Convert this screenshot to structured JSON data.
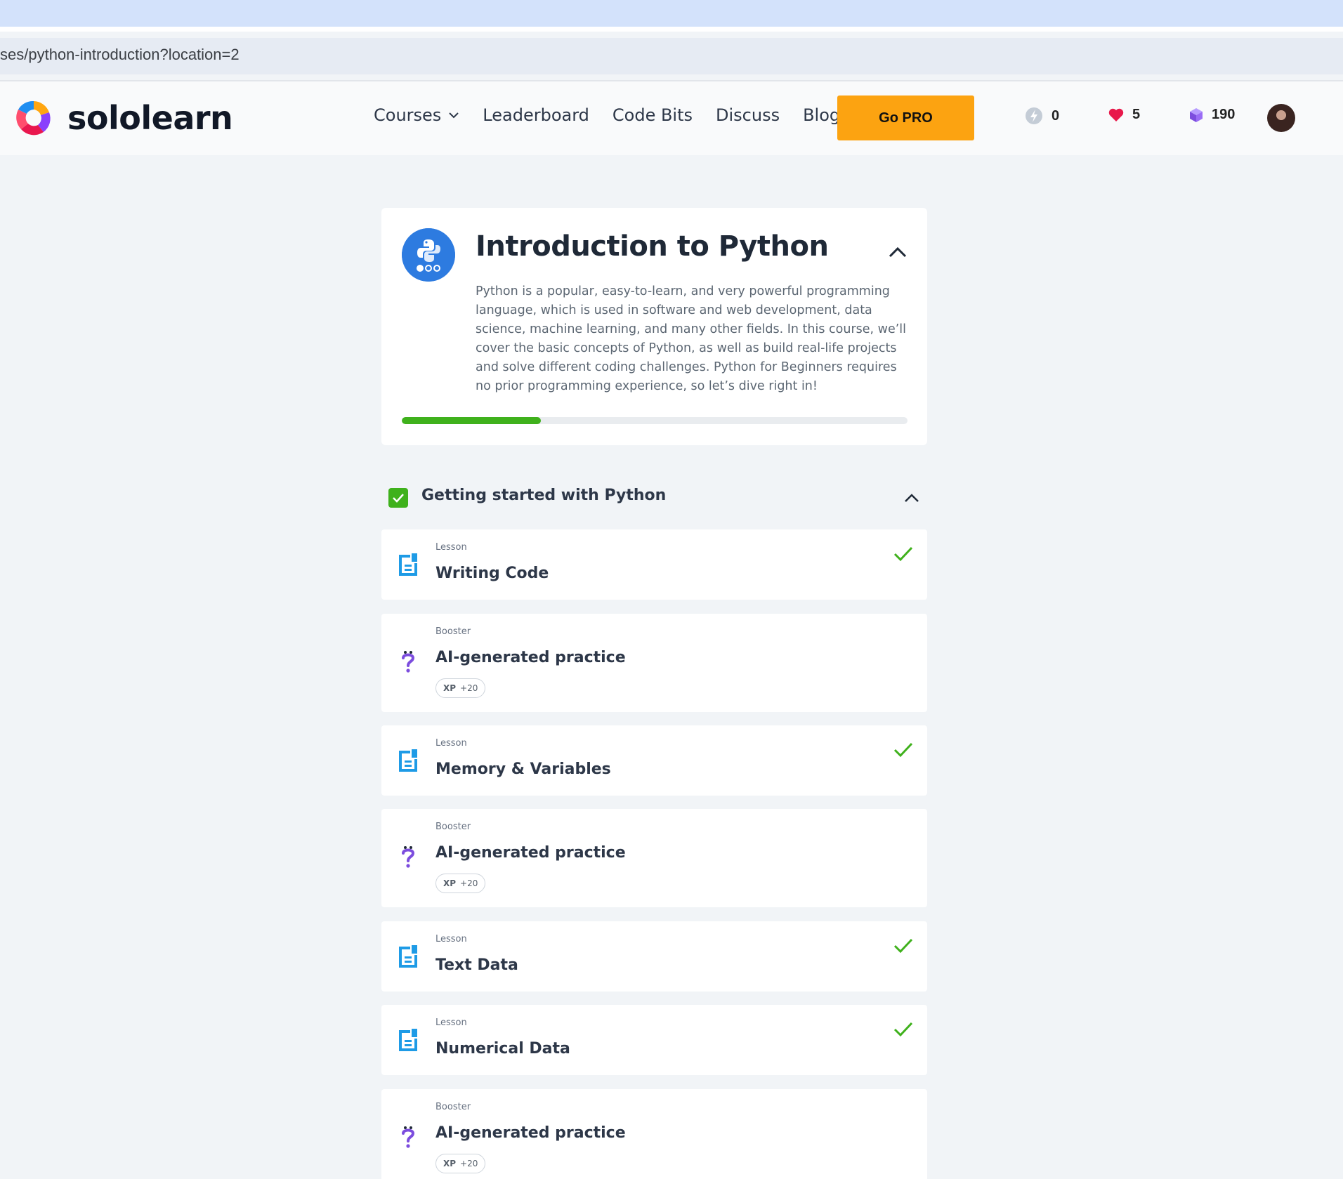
{
  "browser": {
    "url": "ses/python-introduction?location=2"
  },
  "nav": {
    "brand": "sololearn",
    "links": [
      {
        "label": "Courses",
        "has_dropdown": true
      },
      {
        "label": "Leaderboard"
      },
      {
        "label": "Code Bits"
      },
      {
        "label": "Discuss"
      },
      {
        "label": "Blog"
      }
    ],
    "go_pro_label": "Go PRO",
    "stats": {
      "streak": "0",
      "hearts": "5",
      "gems": "190"
    }
  },
  "course": {
    "title": "Introduction to Python",
    "description": "Python is a popular, easy-to-learn, and very powerful programming language, which is used in software and web development, data science, machine learning, and many other fields. In this course, we’ll cover the basic concepts of Python, as well as build real-life projects and solve different coding challenges. Python for Beginners requires no prior programming experience, so let’s dive right in!",
    "progress": 0.275
  },
  "module": {
    "title": "Getting started with Python",
    "completed": true,
    "items": [
      {
        "kind": "Lesson",
        "title": "Writing Code",
        "completed": true
      },
      {
        "kind": "Booster",
        "title": "AI-generated practice",
        "xp_label": "XP",
        "xp_value": "+20"
      },
      {
        "kind": "Lesson",
        "title": "Memory & Variables",
        "completed": true
      },
      {
        "kind": "Booster",
        "title": "AI-generated practice",
        "xp_label": "XP",
        "xp_value": "+20"
      },
      {
        "kind": "Lesson",
        "title": "Text Data",
        "completed": true
      },
      {
        "kind": "Lesson",
        "title": "Numerical Data",
        "completed": true
      },
      {
        "kind": "Booster",
        "title": "AI-generated practice",
        "xp_label": "XP",
        "xp_value": "+20"
      }
    ]
  },
  "colors": {
    "accent_orange": "#fca311",
    "success_green": "#3fb11c",
    "python_blue": "#2d7be0",
    "lesson_icon_blue": "#1e9be6",
    "booster_purple": "#7c4dde",
    "heart_red": "#e8194b",
    "gem_purple": "#8b5cf6"
  }
}
